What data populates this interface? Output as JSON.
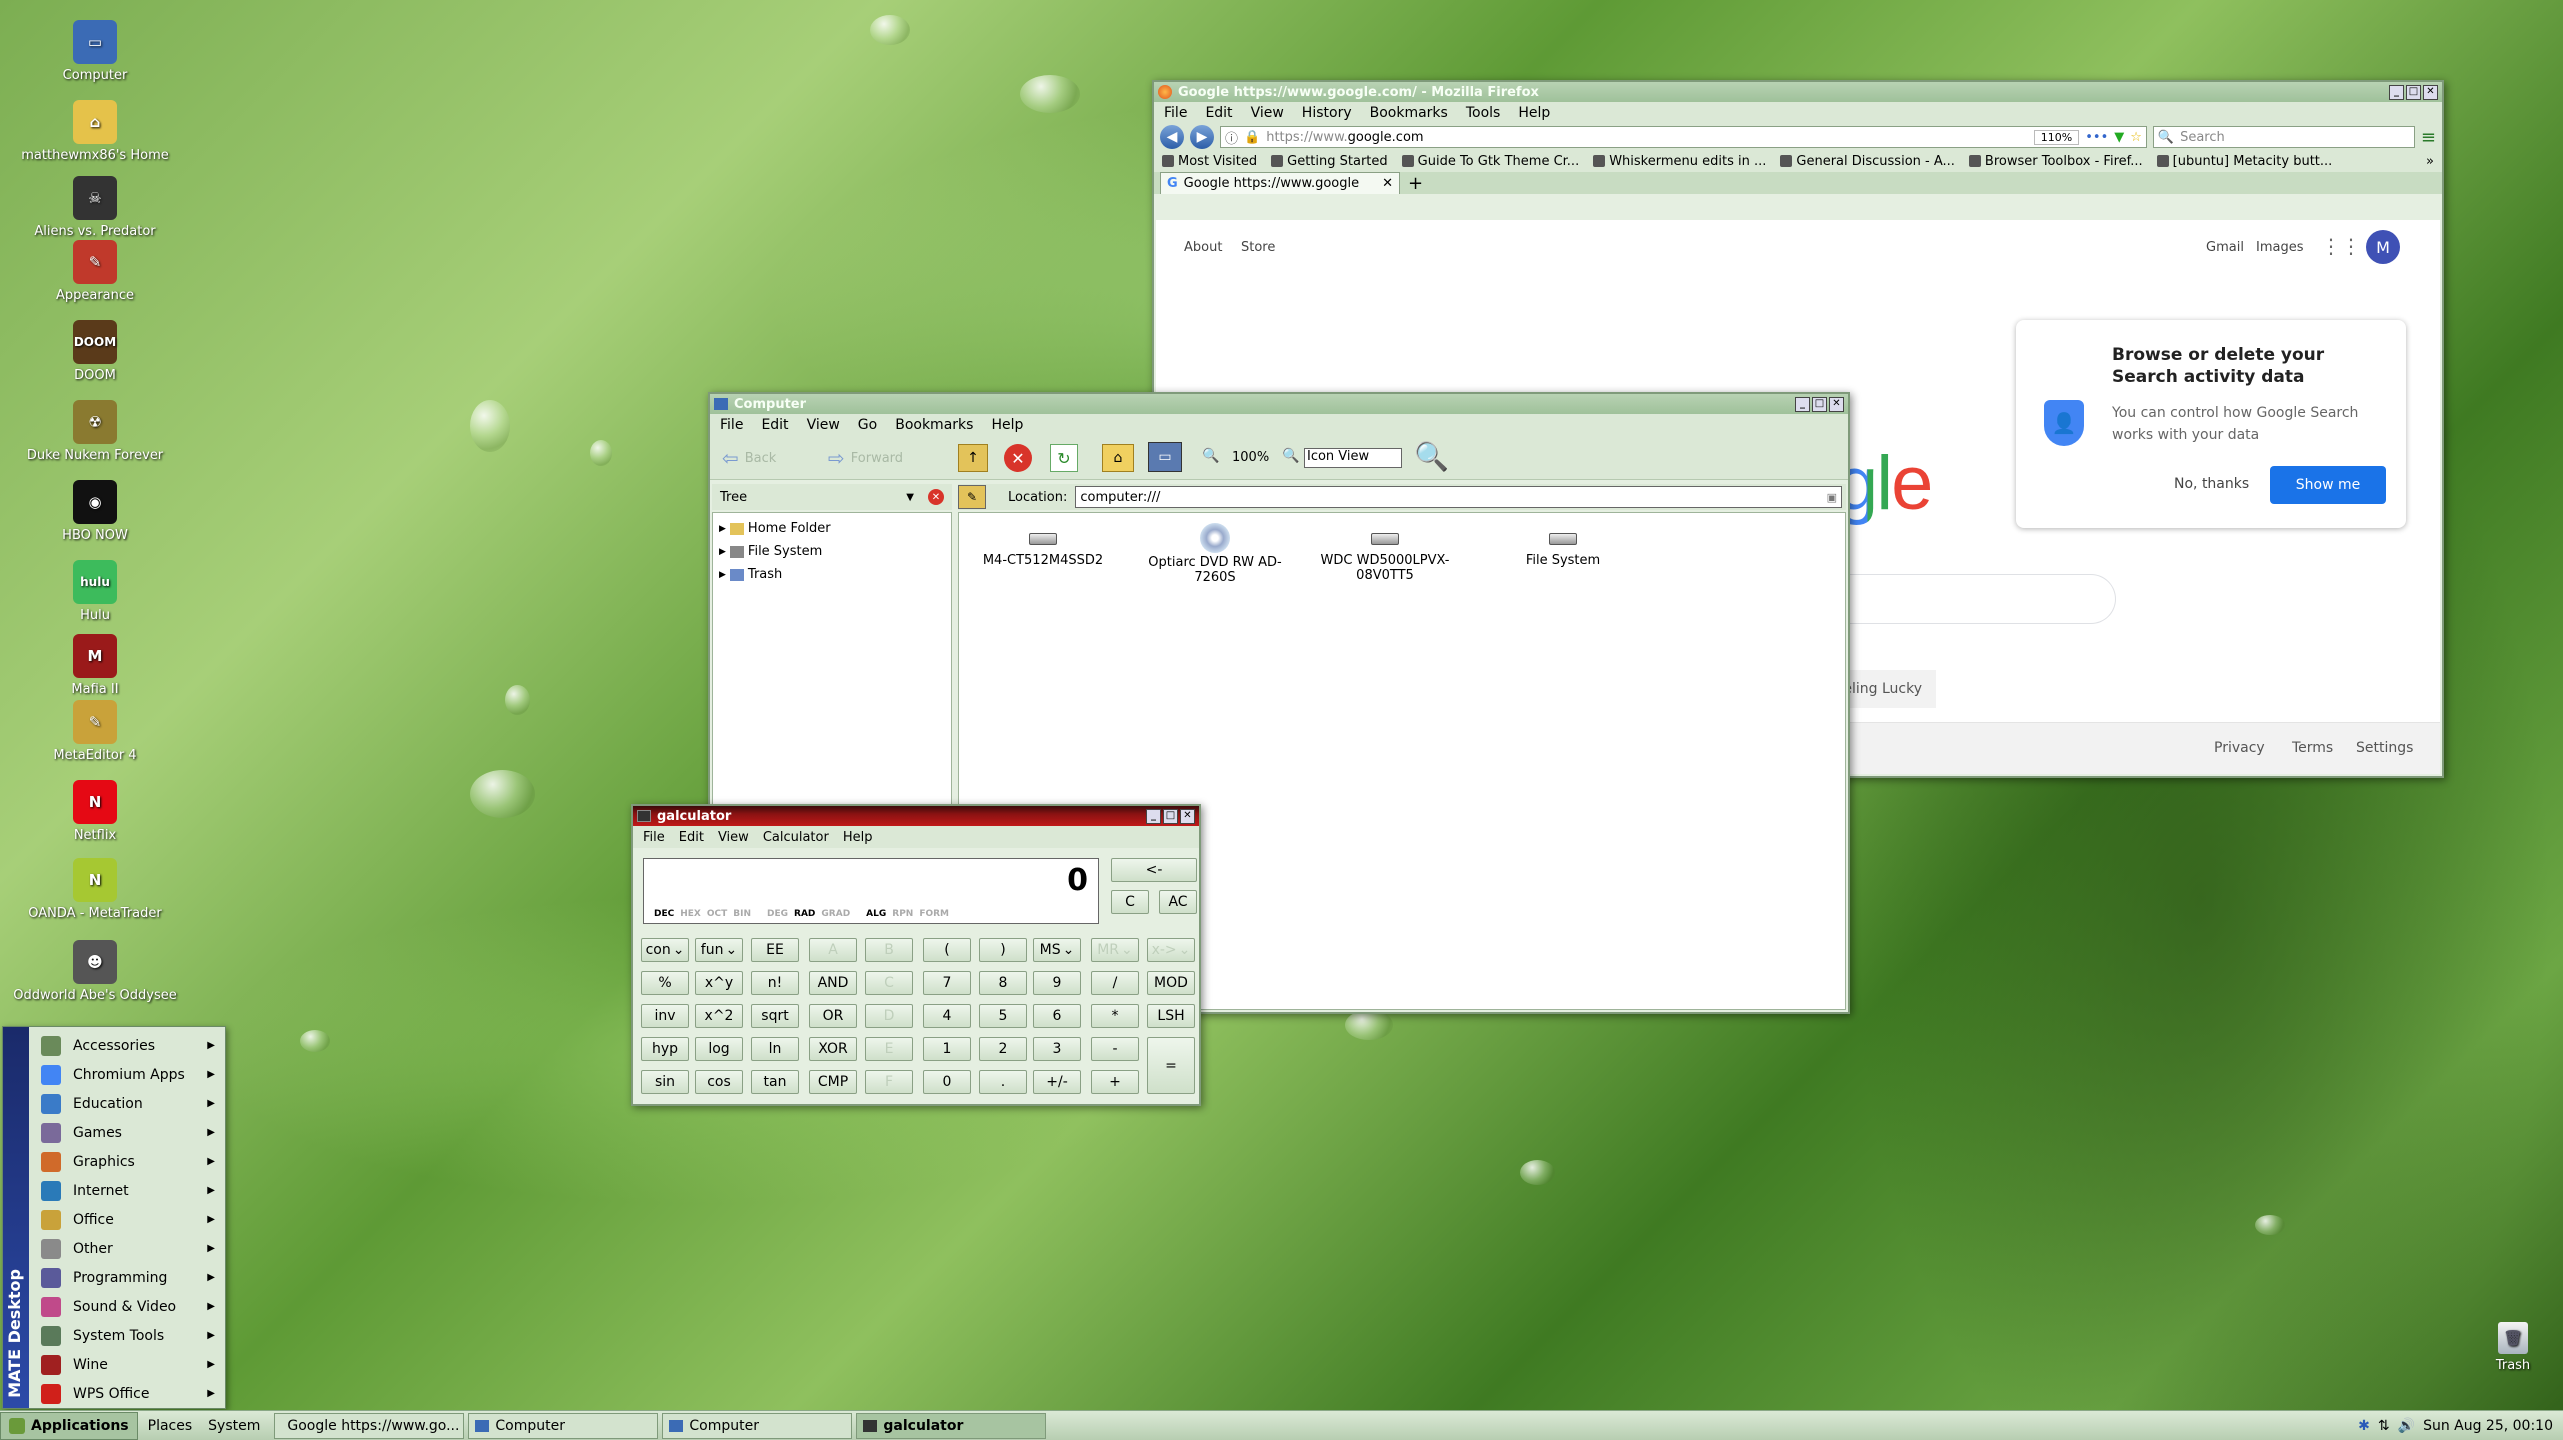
{
  "desktop": {
    "icons": [
      {
        "label": "Computer",
        "color": "#3b6bb5",
        "glyph": "▭"
      },
      {
        "label": "matthewmx86's Home",
        "color": "#e5c24a",
        "glyph": "⌂"
      },
      {
        "label": "Aliens vs. Predator",
        "color": "#333333",
        "glyph": "☠"
      },
      {
        "label": "Appearance",
        "color": "#c0392b",
        "glyph": "✎"
      },
      {
        "label": "DOOM",
        "color": "#5a3a1a",
        "glyph": "DOOM"
      },
      {
        "label": "Duke Nukem Forever",
        "color": "#8a7a30",
        "glyph": "☢"
      },
      {
        "label": "HBO NOW",
        "color": "#111111",
        "glyph": "◉"
      },
      {
        "label": "Hulu",
        "color": "#3dbb5c",
        "glyph": "hulu"
      },
      {
        "label": "Mafia II",
        "color": "#9a1a1a",
        "glyph": "M"
      },
      {
        "label": "MetaEditor 4",
        "color": "#c9a23a",
        "glyph": "✎"
      },
      {
        "label": "Netflix",
        "color": "#e50914",
        "glyph": "N"
      },
      {
        "label": "OANDA - MetaTrader",
        "color": "#a6c832",
        "glyph": "N"
      },
      {
        "label": "Oddworld Abe's Oddysee",
        "color": "#555555",
        "glyph": "☻"
      }
    ],
    "trash_label": "Trash"
  },
  "firefox": {
    "title": "Google https://www.google.com/ - Mozilla Firefox",
    "menu": [
      "File",
      "Edit",
      "View",
      "History",
      "Bookmarks",
      "Tools",
      "Help"
    ],
    "url_prefix": "https://www.",
    "url_domain": "google.com",
    "zoom": "110%",
    "search_placeholder": "Search",
    "bookmarks": [
      "Most Visited",
      "Getting Started",
      "Guide To Gtk Theme Cr...",
      "Whiskermenu edits in ...",
      "General Discussion - A...",
      "Browser Toolbox - Firef...",
      "[ubuntu] Metacity butt..."
    ],
    "tab_title": "Google https://www.google",
    "google": {
      "about": "About",
      "store": "Store",
      "gmail": "Gmail",
      "images": "Images",
      "avatar": "M",
      "logo_partial": "gle",
      "popup_title": "Browse or delete your Search activity data",
      "popup_body": "You can control how Google Search works with your data",
      "no_thanks": "No, thanks",
      "show_me": "Show me",
      "lucky_partial": "eeling Lucky",
      "footer": [
        "Privacy",
        "Terms",
        "Settings"
      ]
    }
  },
  "caja": {
    "title": "Computer",
    "menu": [
      "File",
      "Edit",
      "View",
      "Go",
      "Bookmarks",
      "Help"
    ],
    "back": "Back",
    "forward": "Forward",
    "zoom": "100%",
    "view_mode": "Icon View",
    "side_label": "Tree",
    "location_label": "Location:",
    "location": "computer:///",
    "tree": [
      "Home Folder",
      "File System",
      "Trash"
    ],
    "items": [
      {
        "label": "M4-CT512M4SSD2"
      },
      {
        "label": "Optiarc DVD RW AD-7260S"
      },
      {
        "label": "WDC WD5000LPVX-08V0TT5"
      },
      {
        "label": "File System"
      }
    ]
  },
  "calc": {
    "title": "galculator",
    "menu": [
      "File",
      "Edit",
      "View",
      "Calculator",
      "Help"
    ],
    "display": "0",
    "modes": [
      "DEC",
      "HEX",
      "OCT",
      "BIN",
      "DEG",
      "RAD",
      "GRAD",
      "ALG",
      "RPN",
      "FORM"
    ],
    "top_buttons": [
      "<-",
      "C",
      "AC"
    ],
    "rows": [
      [
        "con",
        "fun",
        "EE",
        "A",
        "B",
        "(",
        ")",
        "MS",
        "MR",
        "x->"
      ],
      [
        "%",
        "x^y",
        "n!",
        "AND",
        "C",
        "7",
        "8",
        "9",
        "/",
        "MOD"
      ],
      [
        "inv",
        "x^2",
        "sqrt",
        "OR",
        "D",
        "4",
        "5",
        "6",
        "*",
        "LSH"
      ],
      [
        "hyp",
        "log",
        "ln",
        "XOR",
        "E",
        "1",
        "2",
        "3",
        "-",
        "="
      ],
      [
        "sin",
        "cos",
        "tan",
        "CMP",
        "F",
        "0",
        ".",
        "+/-",
        "+",
        ""
      ]
    ]
  },
  "menu": {
    "side_label": "MATE Desktop",
    "items": [
      "Accessories",
      "Chromium Apps",
      "Education",
      "Games",
      "Graphics",
      "Internet",
      "Office",
      "Other",
      "Programming",
      "Sound & Video",
      "System Tools",
      "Wine",
      "WPS Office"
    ],
    "colors": [
      "#6a8a5a",
      "#4285f4",
      "#3a7bc8",
      "#7a6a9a",
      "#d06a2a",
      "#2a7ab8",
      "#c9a23a",
      "#8a8a8a",
      "#5a5a9a",
      "#c04a8a",
      "#5a7a5a",
      "#a02020",
      "#d0201a"
    ]
  },
  "panel": {
    "applications": "Applications",
    "places": "Places",
    "system": "System",
    "tasks": [
      "Google https://www.go...",
      "Computer",
      "Computer",
      "galculator"
    ],
    "clock": "Sun Aug 25, 00:10"
  }
}
